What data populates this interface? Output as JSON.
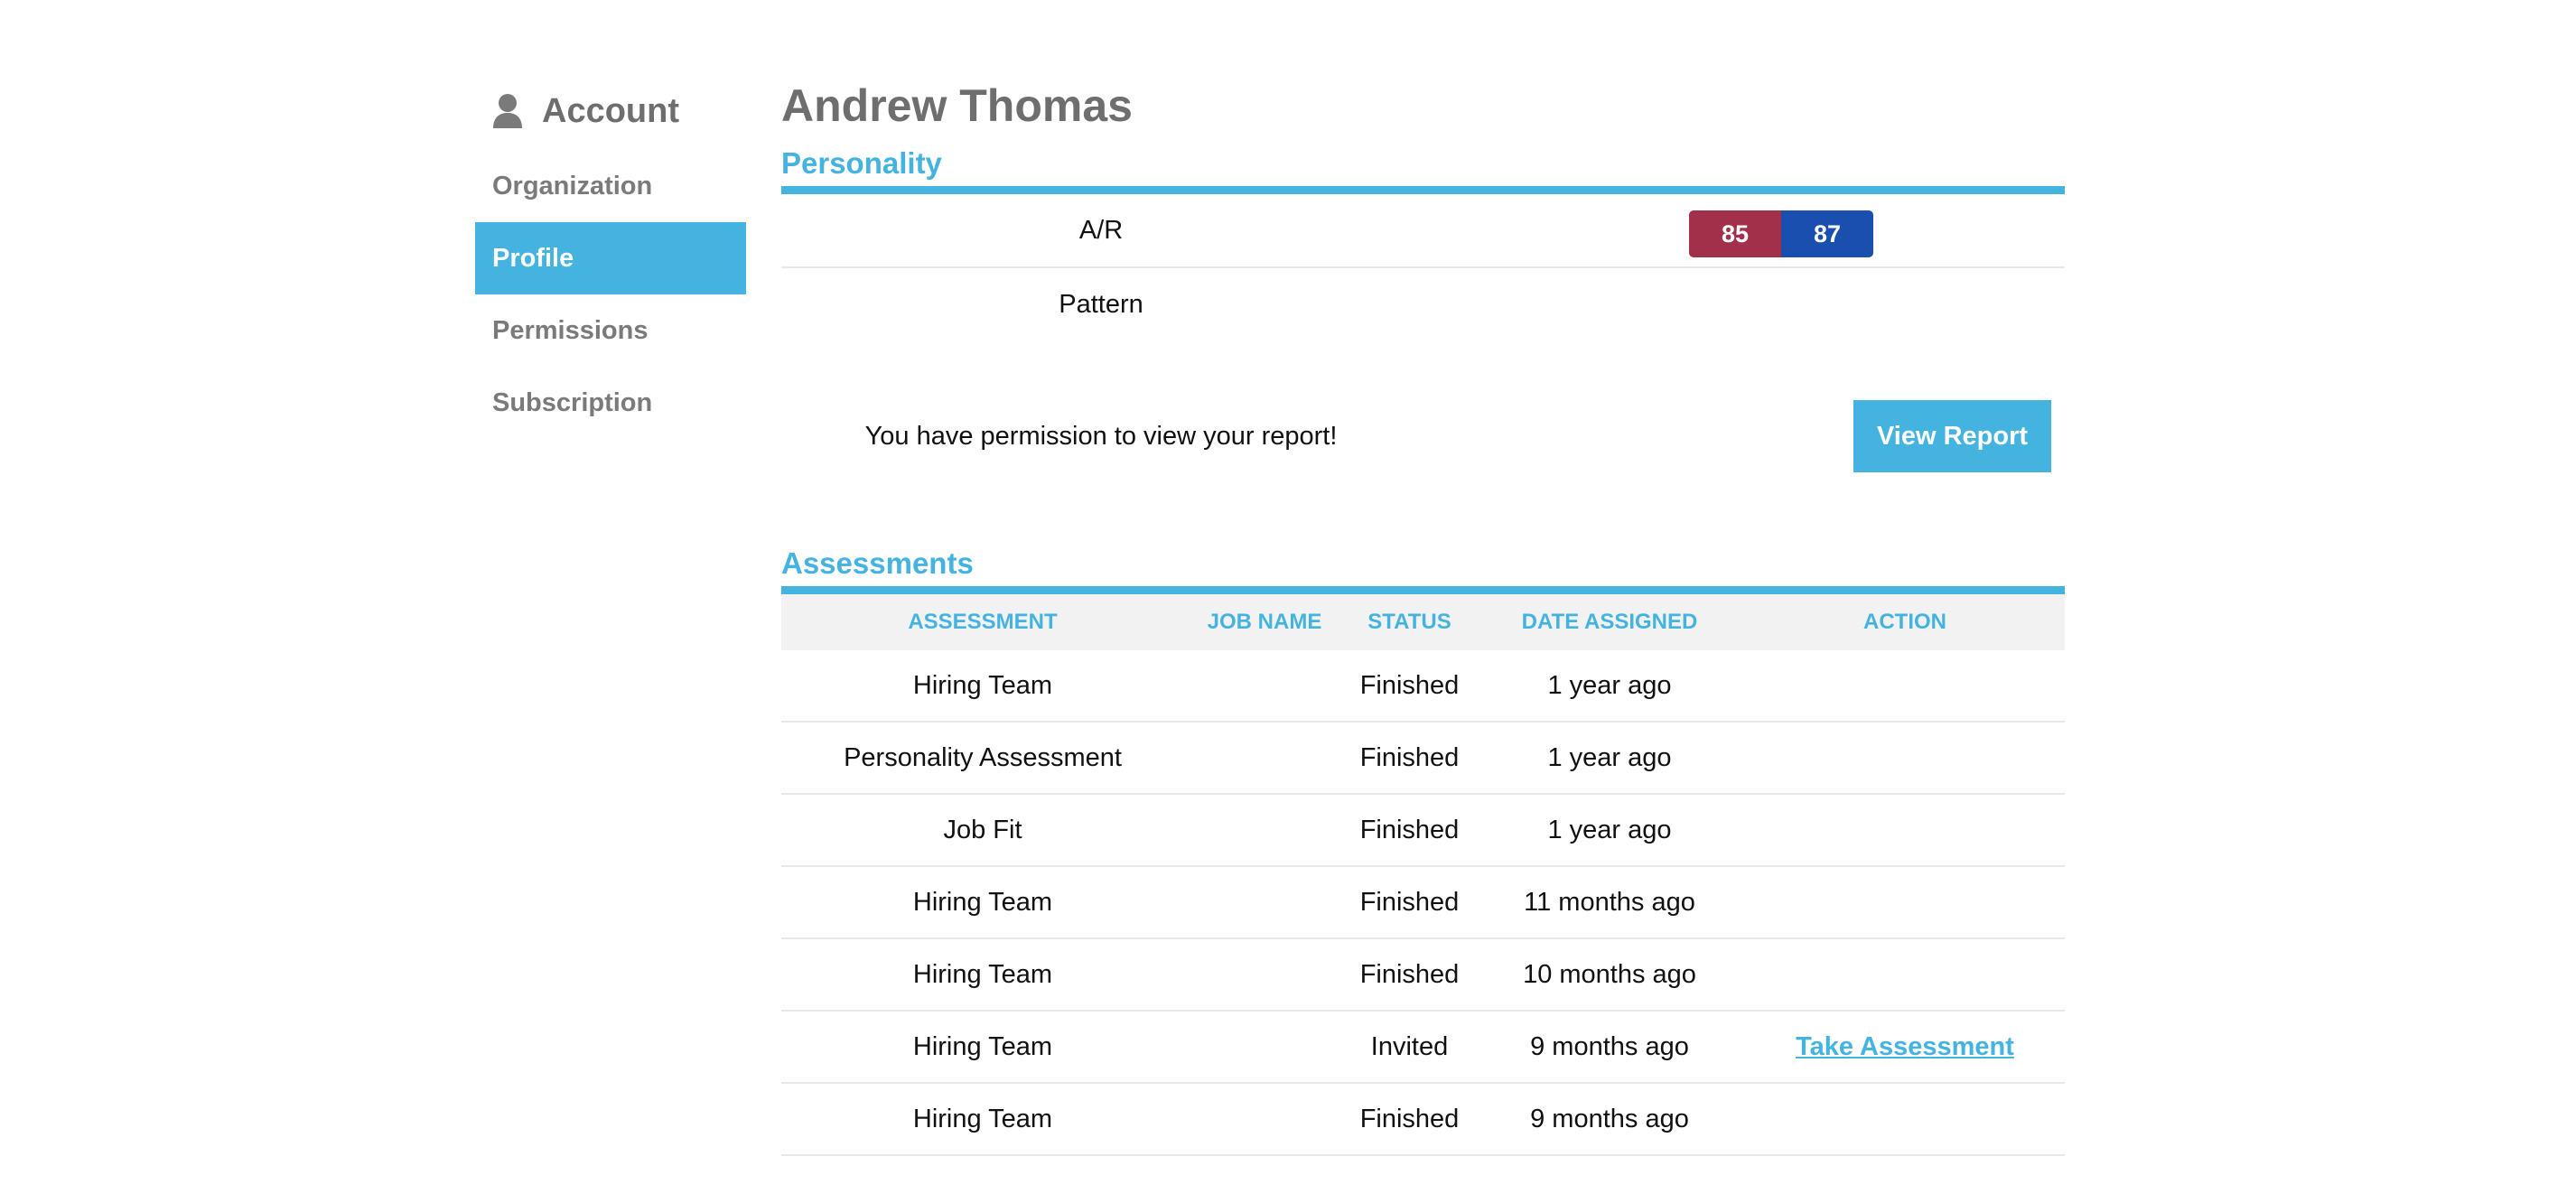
{
  "sidebar": {
    "title": "Account",
    "icon": "user-icon",
    "items": [
      {
        "label": "Organization",
        "active": false
      },
      {
        "label": "Profile",
        "active": true
      },
      {
        "label": "Permissions",
        "active": false
      },
      {
        "label": "Subscription",
        "active": false
      }
    ]
  },
  "main": {
    "name": "Andrew Thomas",
    "personality": {
      "title": "Personality",
      "rows": [
        {
          "label": "A/R"
        },
        {
          "label": "Pattern"
        }
      ],
      "ar_scores": {
        "left": "85",
        "right": "87"
      }
    },
    "report": {
      "message": "You have permission to view your report!",
      "button_label": "View Report"
    },
    "assessments": {
      "title": "Assessments",
      "columns": [
        "Assessment",
        "Job Name",
        "Status",
        "Date Assigned",
        "Action"
      ],
      "rows": [
        {
          "assessment": "Hiring Team",
          "job_name": "",
          "status": "Finished",
          "date": "1 year ago",
          "action": ""
        },
        {
          "assessment": "Personality Assessment",
          "job_name": "",
          "status": "Finished",
          "date": "1 year ago",
          "action": ""
        },
        {
          "assessment": "Job Fit",
          "job_name": "",
          "status": "Finished",
          "date": "1 year ago",
          "action": ""
        },
        {
          "assessment": "Hiring Team",
          "job_name": "",
          "status": "Finished",
          "date": "11 months ago",
          "action": ""
        },
        {
          "assessment": "Hiring Team",
          "job_name": "",
          "status": "Finished",
          "date": "10 months ago",
          "action": ""
        },
        {
          "assessment": "Hiring Team",
          "job_name": "",
          "status": "Invited",
          "date": "9 months ago",
          "action": "Take Assessment"
        },
        {
          "assessment": "Hiring Team",
          "job_name": "",
          "status": "Finished",
          "date": "9 months ago",
          "action": ""
        }
      ]
    }
  },
  "colors": {
    "accent": "#45b3e0",
    "ar_left": "#a3304a",
    "ar_right": "#1a4fb0",
    "muted_text": "#6e6e6e"
  }
}
